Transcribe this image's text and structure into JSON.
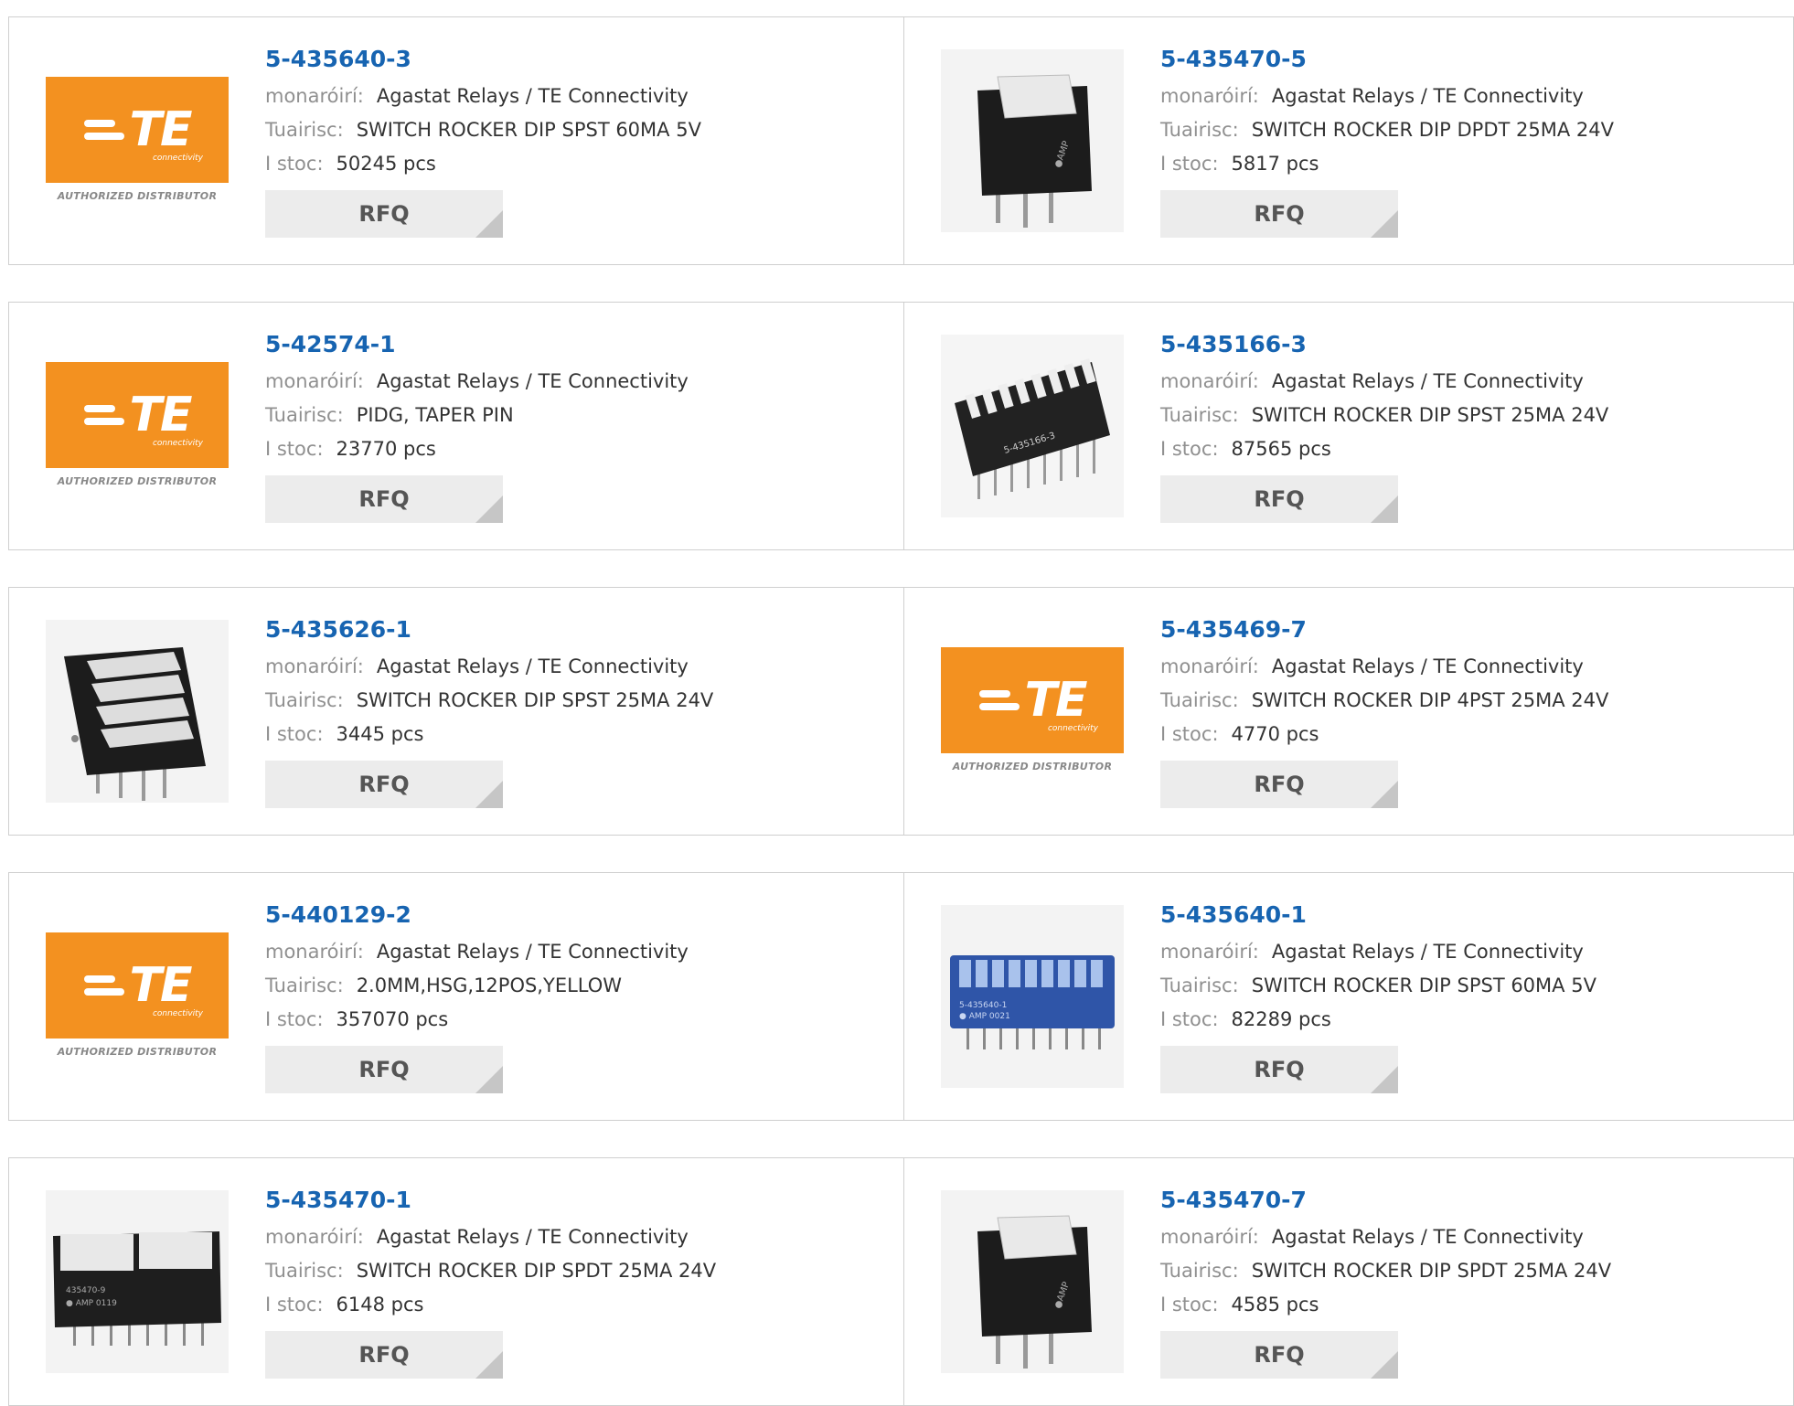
{
  "labels": {
    "manufacturer": "monaróirí:",
    "description": "Tuairisc:",
    "stock": "I stoc:",
    "rfq": "RFQ",
    "logo_brand": "TE",
    "logo_sub": "connectivity",
    "logo_authorized": "AUTHORIZED DISTRIBUTOR"
  },
  "products": [
    {
      "part": "5-435640-3",
      "manufacturer": "Agastat Relays / TE Connectivity",
      "description": "SWITCH ROCKER DIP SPST 60MA 5V",
      "stock": "50245 pcs",
      "image": "te-logo"
    },
    {
      "part": "5-435470-5",
      "manufacturer": "Agastat Relays / TE Connectivity",
      "description": "SWITCH ROCKER DIP DPDT 25MA 24V",
      "stock": "5817 pcs",
      "image": "rocker-switch-single"
    },
    {
      "part": "5-42574-1",
      "manufacturer": "Agastat Relays / TE Connectivity",
      "description": "PIDG, TAPER PIN",
      "stock": "23770 pcs",
      "image": "te-logo"
    },
    {
      "part": "5-435166-3",
      "manufacturer": "Agastat Relays / TE Connectivity",
      "description": "SWITCH ROCKER DIP SPST 25MA 24V",
      "stock": "87565 pcs",
      "image": "dip-switch-8"
    },
    {
      "part": "5-435626-1",
      "manufacturer": "Agastat Relays / TE Connectivity",
      "description": "SWITCH ROCKER DIP SPST 25MA 24V",
      "stock": "3445 pcs",
      "image": "dip-switch-4"
    },
    {
      "part": "5-435469-7",
      "manufacturer": "Agastat Relays / TE Connectivity",
      "description": "SWITCH ROCKER DIP 4PST 25MA 24V",
      "stock": "4770 pcs",
      "image": "te-logo"
    },
    {
      "part": "5-440129-2",
      "manufacturer": "Agastat Relays / TE Connectivity",
      "description": "2.0MM,HSG,12POS,YELLOW",
      "stock": "357070 pcs",
      "image": "te-logo"
    },
    {
      "part": "5-435640-1",
      "manufacturer": "Agastat Relays / TE Connectivity",
      "description": "SWITCH ROCKER DIP SPST 60MA 5V",
      "stock": "82289 pcs",
      "image": "dip-switch-blue"
    },
    {
      "part": "5-435470-1",
      "manufacturer": "Agastat Relays / TE Connectivity",
      "description": "SWITCH ROCKER DIP SPDT 25MA 24V",
      "stock": "6148 pcs",
      "image": "dip-switch-2"
    },
    {
      "part": "5-435470-7",
      "manufacturer": "Agastat Relays / TE Connectivity",
      "description": "SWITCH ROCKER DIP SPDT 25MA 24V",
      "stock": "4585 pcs",
      "image": "rocker-switch-single"
    }
  ],
  "colors": {
    "part_link": "#1764b1",
    "label_gray": "#909090",
    "te_orange": "#f39120",
    "rfq_bg": "#ececec"
  }
}
